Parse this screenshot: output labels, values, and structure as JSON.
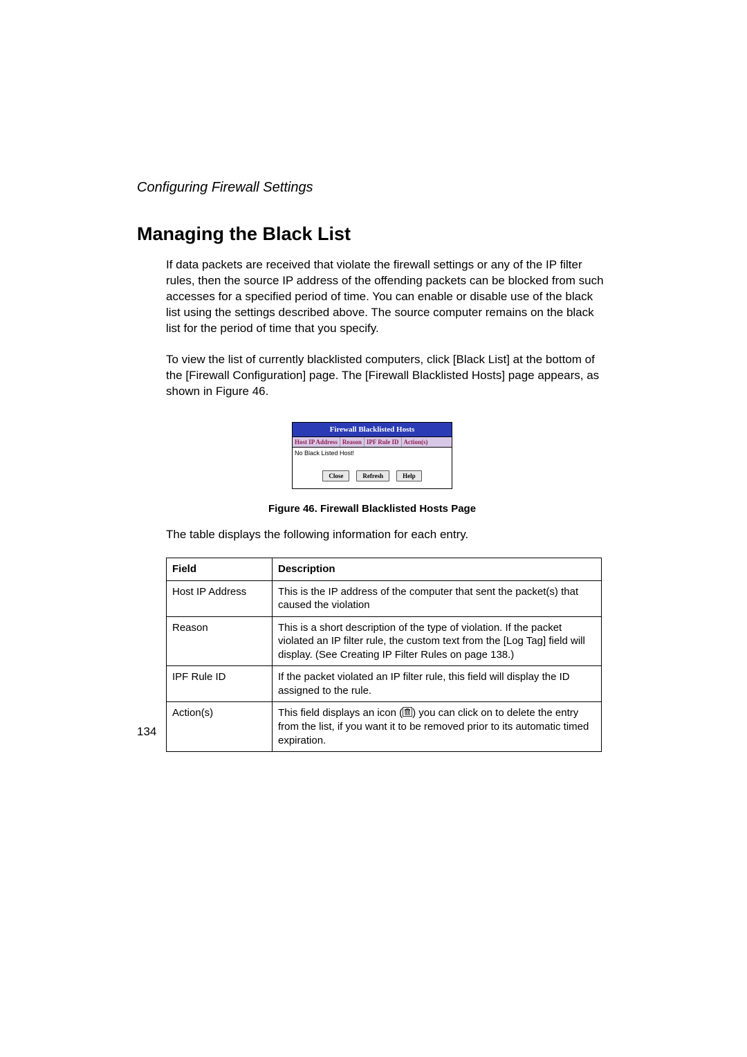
{
  "section_header": "Configuring Firewall Settings",
  "heading": "Managing the Black List",
  "para1": "If data packets are received that violate the firewall settings or any of the IP filter rules, then the source IP address of the offending packets can be blocked from such accesses for a specified period of time. You can enable or disable use of the black list using the settings described above. The source computer remains on the black list for the period of time that you specify.",
  "para2": "To view the list of currently blacklisted computers, click [Black List] at the bottom of the [Firewall Configuration] page. The [Firewall Blacklisted Hosts] page appears, as shown in Figure 46.",
  "figure": {
    "title": "Firewall Blacklisted Hosts",
    "columns": [
      "Host IP Address",
      "Reason",
      "IPF Rule ID",
      "Action(s)"
    ],
    "empty_msg": "No Black Listed Host!",
    "buttons": {
      "close": "Close",
      "refresh": "Refresh",
      "help": "Help"
    }
  },
  "figure_caption": "Figure 46.  Firewall Blacklisted Hosts Page",
  "para3": "The table displays the following information for each entry.",
  "table": {
    "head_field": "Field",
    "head_desc": "Description",
    "rows": [
      {
        "field": "Host IP Address",
        "desc": "This is the IP address of the computer that sent the packet(s) that caused the violation"
      },
      {
        "field": "Reason",
        "desc": "This is a short description of the type of violation. If the packet violated an IP filter rule, the custom text from the [Log Tag] field will display. (See Creating IP Filter Rules on page 138.)"
      },
      {
        "field": "IPF Rule ID",
        "desc": "If the packet violated an IP filter rule, this field will display the ID assigned to the rule."
      },
      {
        "field": "Action(s)",
        "desc_pre": "This field displays an icon (",
        "desc_post": ") you can click on to delete the entry from the list, if you want it to be removed prior to its automatic timed expiration."
      }
    ]
  },
  "page_number": "134"
}
